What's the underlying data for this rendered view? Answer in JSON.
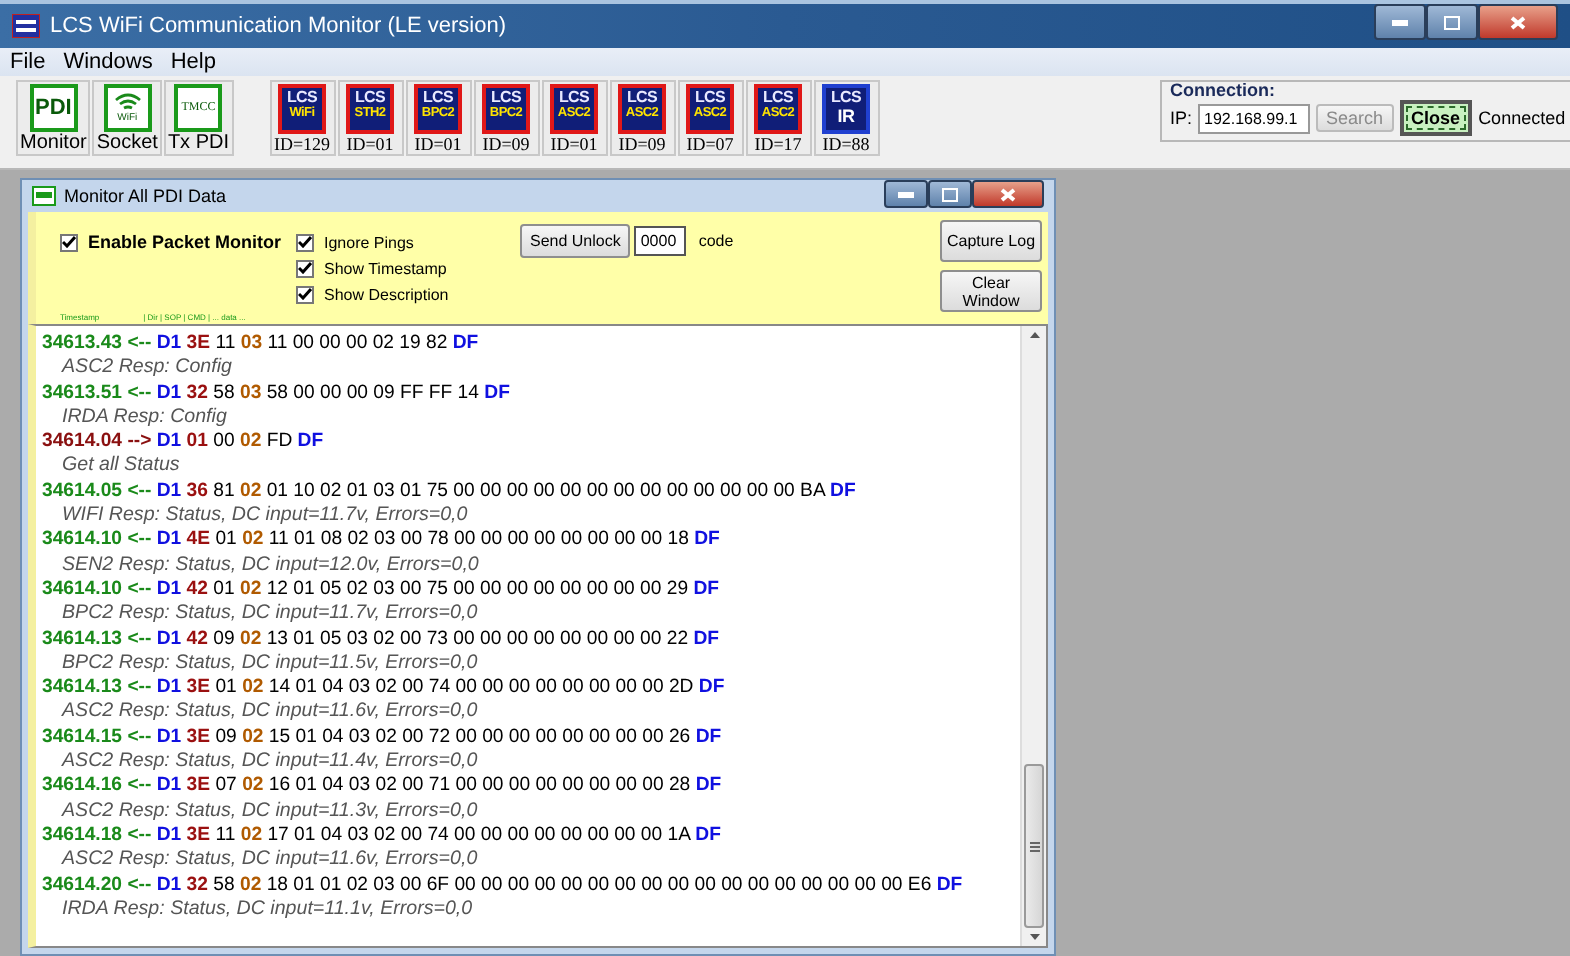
{
  "window": {
    "title": "LCS WiFi Communication Monitor (LE version)"
  },
  "menu": [
    "File",
    "Windows",
    "Help"
  ],
  "tools": [
    {
      "kind": "pdi",
      "icon_text": "PDI",
      "label": "Monitor"
    },
    {
      "kind": "wifi",
      "icon_text": "WiFi",
      "label": "Socket"
    },
    {
      "kind": "tmcc",
      "icon_text": "TMCC",
      "label": "Tx PDI"
    }
  ],
  "devices": [
    {
      "logo": "LCS",
      "badge": "WiFi",
      "id": "ID=129",
      "color": "#e01818"
    },
    {
      "logo": "LCS",
      "badge": "STH2",
      "id": "ID=01",
      "color": "#e01818"
    },
    {
      "logo": "LCS",
      "badge": "BPC2",
      "id": "ID=01",
      "color": "#e01818"
    },
    {
      "logo": "LCS",
      "badge": "BPC2",
      "id": "ID=09",
      "color": "#e01818"
    },
    {
      "logo": "LCS",
      "badge": "ASC2",
      "id": "ID=01",
      "color": "#e01818"
    },
    {
      "logo": "LCS",
      "badge": "ASC2",
      "id": "ID=09",
      "color": "#e01818"
    },
    {
      "logo": "LCS",
      "badge": "ASC2",
      "id": "ID=07",
      "color": "#e01818"
    },
    {
      "logo": "LCS",
      "badge": "ASC2",
      "id": "ID=17",
      "color": "#e01818"
    },
    {
      "logo": "LCS",
      "badge": "IR",
      "id": "ID=88",
      "color": "#2040d0"
    }
  ],
  "connection": {
    "title": "Connection:",
    "ip_label": "IP:",
    "ip": "192.168.99.1",
    "search_button": "Search",
    "search_disabled": true,
    "close_button": "Close",
    "status": "Connected"
  },
  "monitor": {
    "title": "Monitor All PDI Data",
    "enable": {
      "label": "Enable Packet Monitor",
      "checked": true
    },
    "options": [
      {
        "label": "Ignore Pings",
        "checked": true
      },
      {
        "label": "Show Timestamp",
        "checked": true
      },
      {
        "label": "Show Description",
        "checked": true
      }
    ],
    "unlock_button": "Send Unlock",
    "code_value": "0000",
    "code_label": "code",
    "capture_button": "Capture Log",
    "clear_button": "Clear Window",
    "header": [
      "Timestamp",
      "| Dir | SOP | CMD | ... data ..."
    ],
    "packets": [
      {
        "kind": "in",
        "timestamp": "34613.43",
        "arrow": "<--",
        "sop": "D1",
        "addr": "3E",
        "b3": "11",
        "cmd": "03",
        "data": "11 00 00 00 02 19 82",
        "eop": "DF",
        "description": "ASC2 Resp: Config"
      },
      {
        "kind": "in",
        "timestamp": "34613.51",
        "arrow": "<--",
        "sop": "D1",
        "addr": "32",
        "b3": "58",
        "cmd": "03",
        "data": "58 00 00 00 09 FF FF 14",
        "eop": "DF",
        "description": "IRDA Resp: Config"
      },
      {
        "kind": "out",
        "timestamp": "34614.04",
        "arrow": "-->",
        "sop": "D1",
        "addr": "01",
        "b3": "00",
        "cmd": "02",
        "data": "FD",
        "eop": "DF",
        "description": "Get all Status"
      },
      {
        "kind": "in",
        "timestamp": "34614.05",
        "arrow": "<--",
        "sop": "D1",
        "addr": "36",
        "b3": "81",
        "cmd": "02",
        "data": "01 10 02 01 03 01 75 00 00 00 00 00 00 00 00 00 00 00 00 00 BA",
        "eop": "DF",
        "description": "WIFI Resp: Status, DC input=11.7v, Errors=0,0"
      },
      {
        "kind": "in",
        "timestamp": "34614.10",
        "arrow": "<--",
        "sop": "D1",
        "addr": "4E",
        "b3": "01",
        "cmd": "02",
        "data": "11 01 08 02 03 00 78 00 00 00 00 00 00 00 00 18",
        "eop": "DF",
        "description": "SEN2 Resp: Status, DC input=12.0v, Errors=0,0"
      },
      {
        "kind": "in",
        "timestamp": "34614.10",
        "arrow": "<--",
        "sop": "D1",
        "addr": "42",
        "b3": "01",
        "cmd": "02",
        "data": "12 01 05 02 03 00 75 00 00 00 00 00 00 00 00 29",
        "eop": "DF",
        "description": "BPC2 Resp: Status, DC input=11.7v, Errors=0,0"
      },
      {
        "kind": "in",
        "timestamp": "34614.13",
        "arrow": "<--",
        "sop": "D1",
        "addr": "42",
        "b3": "09",
        "cmd": "02",
        "data": "13 01 05 03 02 00 73 00 00 00 00 00 00 00 00 22",
        "eop": "DF",
        "description": "BPC2 Resp: Status, DC input=11.5v, Errors=0,0"
      },
      {
        "kind": "in",
        "timestamp": "34614.13",
        "arrow": "<--",
        "sop": "D1",
        "addr": "3E",
        "b3": "01",
        "cmd": "02",
        "data": "14 01 04 03 02 00 74 00 00 00 00 00 00 00 00 2D",
        "eop": "DF",
        "description": "ASC2 Resp: Status, DC input=11.6v, Errors=0,0"
      },
      {
        "kind": "in",
        "timestamp": "34614.15",
        "arrow": "<--",
        "sop": "D1",
        "addr": "3E",
        "b3": "09",
        "cmd": "02",
        "data": "15 01 04 03 02 00 72 00 00 00 00 00 00 00 00 26",
        "eop": "DF",
        "description": "ASC2 Resp: Status, DC input=11.4v, Errors=0,0"
      },
      {
        "kind": "in",
        "timestamp": "34614.16",
        "arrow": "<--",
        "sop": "D1",
        "addr": "3E",
        "b3": "07",
        "cmd": "02",
        "data": "16 01 04 03 02 00 71 00 00 00 00 00 00 00 00 28",
        "eop": "DF",
        "description": "ASC2 Resp: Status, DC input=11.3v, Errors=0,0"
      },
      {
        "kind": "in",
        "timestamp": "34614.18",
        "arrow": "<--",
        "sop": "D1",
        "addr": "3E",
        "b3": "11",
        "cmd": "02",
        "data": "17 01 04 03 02 00 74 00 00 00 00 00 00 00 00 1A",
        "eop": "DF",
        "description": "ASC2 Resp: Status, DC input=11.6v, Errors=0,0"
      },
      {
        "kind": "in",
        "timestamp": "34614.20",
        "arrow": "<--",
        "sop": "D1",
        "addr": "32",
        "b3": "58",
        "cmd": "02",
        "data": "18 01 01 02 03 00 6F 00 00 00 00 00 00 00 00 00 00 00 00 00 00 00 00 00 E6",
        "eop": "DF",
        "description": "IRDA Resp: Status, DC input=11.1v, Errors=0,0"
      }
    ]
  }
}
